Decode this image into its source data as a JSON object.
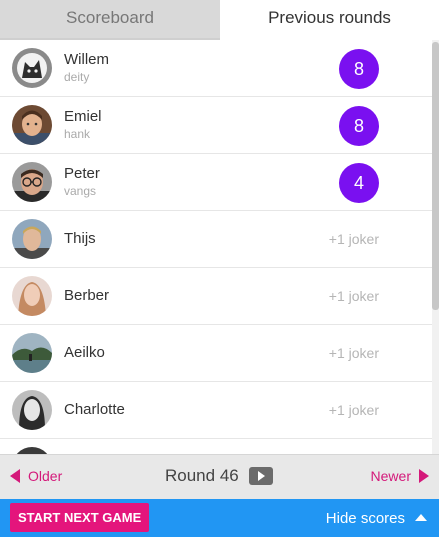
{
  "tabs": [
    {
      "label": "Scoreboard",
      "active": false
    },
    {
      "label": "Previous rounds",
      "active": true
    }
  ],
  "players": [
    {
      "name": "Willem",
      "username": "deity",
      "score": "8",
      "avatar_icon": "wolf-avatar"
    },
    {
      "name": "Emiel",
      "username": "hank",
      "score": "8",
      "avatar_icon": "person-avatar"
    },
    {
      "name": "Peter",
      "username": "vangs",
      "score": "4",
      "avatar_icon": "person-glasses-avatar"
    },
    {
      "name": "Thijs",
      "joker": "+1 joker",
      "avatar_icon": "person-avatar"
    },
    {
      "name": "Berber",
      "joker": "+1 joker",
      "avatar_icon": "person-avatar"
    },
    {
      "name": "Aeilko",
      "joker": "+1 joker",
      "avatar_icon": "landscape-avatar"
    },
    {
      "name": "Charlotte",
      "joker": "+1 joker",
      "avatar_icon": "person-avatar"
    }
  ],
  "navigation": {
    "older_label": "Older",
    "round_label": "Round 46",
    "newer_label": "Newer"
  },
  "footer": {
    "start_label": "START NEXT GAME",
    "hide_label": "Hide scores"
  },
  "colors": {
    "score_badge": "#7a10f0",
    "accent_pink": "#d4197a",
    "start_button": "#e4157c",
    "footer_bar": "#2196f3"
  }
}
